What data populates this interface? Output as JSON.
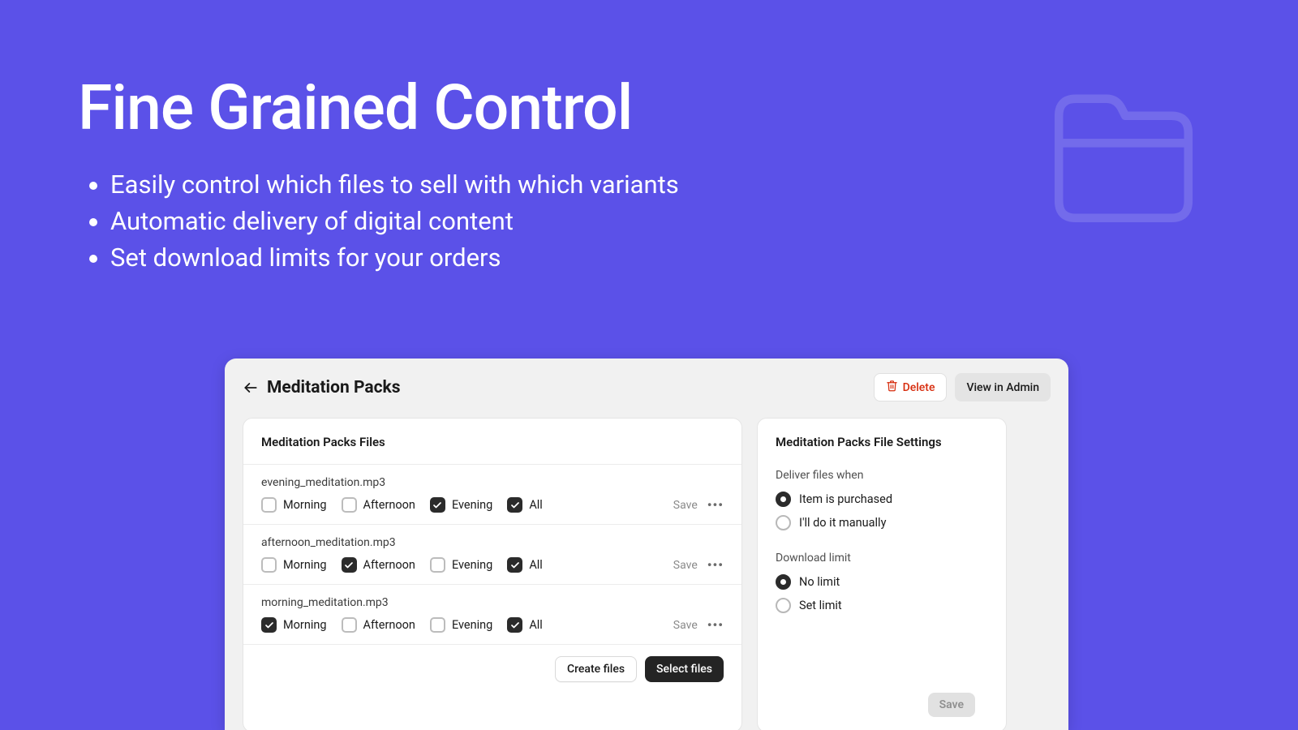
{
  "hero": {
    "title": "Fine Grained Control",
    "bullets": [
      "Easily control which files to sell with which variants",
      "Automatic delivery of digital content",
      "Set download limits for your orders"
    ]
  },
  "panel": {
    "title": "Meditation Packs",
    "delete_label": "Delete",
    "view_admin_label": "View in Admin"
  },
  "files_card": {
    "title": "Meditation Packs Files",
    "variant_labels": {
      "morning": "Morning",
      "afternoon": "Afternoon",
      "evening": "Evening",
      "all": "All"
    },
    "save_label": "Save",
    "files": [
      {
        "name": "evening_meditation.mp3",
        "morning": false,
        "afternoon": false,
        "evening": true,
        "all": true
      },
      {
        "name": "afternoon_meditation.mp3",
        "morning": false,
        "afternoon": true,
        "evening": false,
        "all": true
      },
      {
        "name": "morning_meditation.mp3",
        "morning": true,
        "afternoon": false,
        "evening": false,
        "all": true
      }
    ],
    "create_label": "Create files",
    "select_label": "Select files"
  },
  "settings_card": {
    "title": "Meditation Packs File Settings",
    "deliver": {
      "label": "Deliver files when",
      "options": [
        {
          "label": "Item is purchased",
          "selected": true
        },
        {
          "label": "I'll do it manually",
          "selected": false
        }
      ]
    },
    "download_limit": {
      "label": "Download limit",
      "options": [
        {
          "label": "No limit",
          "selected": true
        },
        {
          "label": "Set limit",
          "selected": false
        }
      ]
    },
    "save_label": "Save"
  }
}
